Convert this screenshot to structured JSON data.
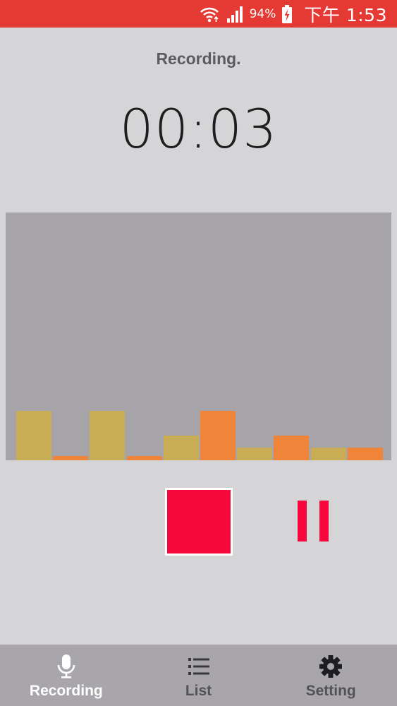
{
  "status_bar": {
    "battery": "94%",
    "time": "下午 1:53",
    "icons": [
      "wifi-icon",
      "signal-icon",
      "battery-charging-icon"
    ]
  },
  "recorder": {
    "status": "Recording.",
    "timer": "00:03"
  },
  "visualizer": {
    "levels": [
      0.2,
      0.016,
      0.2,
      0.016,
      0.1,
      0.2,
      0.05,
      0.1,
      0.05,
      0.05
    ],
    "colors": [
      "#c8ad55",
      "#f0853a",
      "#c8ad55",
      "#f0853a",
      "#c8ad55",
      "#f0853a",
      "#c8ad55",
      "#f0853a",
      "#c8ad55",
      "#f0853a"
    ]
  },
  "controls": {
    "stop_icon": "stop-icon",
    "pause_icon": "pause-icon",
    "accent": "#f7073b"
  },
  "nav": {
    "items": [
      {
        "label": "Recording",
        "icon": "microphone-icon",
        "active": true
      },
      {
        "label": "List",
        "icon": "list-icon",
        "active": false
      },
      {
        "label": "Setting",
        "icon": "gear-icon",
        "active": false
      }
    ]
  },
  "colors": {
    "status_bar": "#e53a34",
    "background": "#d5d4d6",
    "visualizer_bg": "#a6a4a8",
    "nav_bg": "#a8a6aa"
  }
}
